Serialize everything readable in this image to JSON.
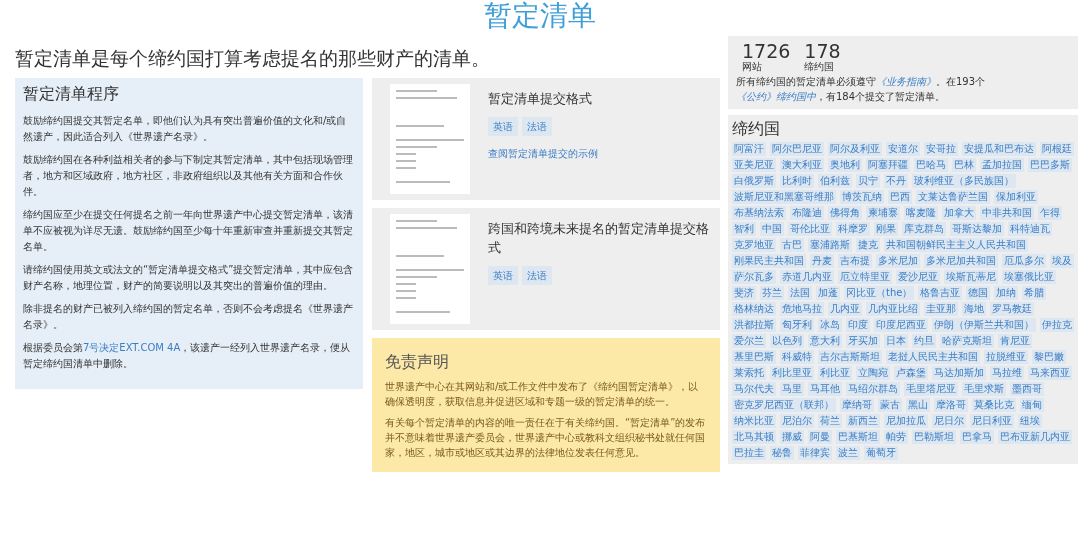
{
  "page_title": "暂定清单",
  "intro": "暂定清单是每个缔约国打算考虑提名的那些财产的清单。",
  "procedure": {
    "title": "暂定清单程序",
    "paragraphs": [
      {
        "segments": [
          {
            "text": "鼓励缔约国提交其暂定名单，即他们认为具有突出普遍价值的文化和/或自然遗产，因此适合列入《世界遗产名录》。",
            "kind": "text"
          }
        ]
      },
      {
        "segments": [
          {
            "text": "鼓励缔约国在各种利益相关者的参与下制定其暂定清单，其中包括现场管理者，地方和区域政府，地方社区，非政府组织以及其他有关方面和合作伙伴。",
            "kind": "text"
          }
        ]
      },
      {
        "segments": [
          {
            "text": "缔约国应至少在提交任何提名之前一年向世界遗产中心提交暂定清单，该清单不应被视为详尽无遗。鼓励缔约国至少每十年重新审查并重新提交其暂定名单。",
            "kind": "text"
          }
        ]
      },
      {
        "segments": [
          {
            "text": "请缔约国使用英文或法文的“暂定清单提交格式”提交暂定清单，其中应包含财产名称，地理位置，财产的简要说明以及其突出的普遍价值的理由。",
            "kind": "text"
          }
        ]
      },
      {
        "segments": [
          {
            "text": "除非提名的财产已被列入缔约国的暂定名单，否则不会考虑提名《世界遗产名录》。",
            "kind": "text"
          }
        ]
      },
      {
        "segments": [
          {
            "text": "根据委员会第",
            "kind": "text"
          },
          {
            "text": "7号决定EXT.COM 4A",
            "kind": "link"
          },
          {
            "text": "，该遗产一经列入世界遗产名录，便从暂定缔约国清单中删除。",
            "kind": "text"
          }
        ]
      }
    ]
  },
  "documents": [
    {
      "title": "暂定清单提交格式",
      "languages": [
        "英语",
        "法语"
      ],
      "example_link": "查阅暂定清单提交的示例"
    },
    {
      "title": "跨国和跨境未来提名的暂定清单提交格式",
      "languages": [
        "英语",
        "法语"
      ]
    }
  ],
  "disclaimer": {
    "title": "免责声明",
    "paragraphs": [
      "世界遗产中心在其网站和/或工作文件中发布了《缔约国暂定清单》，以确保透明度，获取信息并促进区域和专题一级的暂定清单的统一。",
      "有关每个暂定清单的内容的唯一责任在于有关缔约国。“暂定清单”的发布并不意味着世界遗产委员会，世界遗产中心或教科文组织秘书处就任何国家，地区，城市或地区或其边界的法律地位发表任何意见。"
    ]
  },
  "stats": [
    {
      "number": "1726",
      "label": "网站"
    },
    {
      "number": "178",
      "label": "缔约国"
    }
  ],
  "stats_note": {
    "segments": [
      {
        "text": "所有缔约国的暂定清单必须遵守",
        "kind": "text"
      },
      {
        "text": "《业务指南》",
        "kind": "link"
      },
      {
        "text": "。在193个",
        "kind": "text"
      },
      {
        "text": "《公约》缔约国中",
        "kind": "link"
      },
      {
        "text": "，有184个提交了暂定清单。",
        "kind": "text"
      }
    ]
  },
  "states_parties": {
    "title": "缔约国",
    "countries": [
      "阿富汗",
      "阿尔巴尼亚",
      "阿尔及利亚",
      "安道尔",
      "安哥拉",
      "安提瓜和巴布达",
      "阿根廷",
      "亚美尼亚",
      "澳大利亚",
      "奥地利",
      "阿塞拜疆",
      "巴哈马",
      "巴林",
      "孟加拉国",
      "巴巴多斯",
      "白俄罗斯",
      "比利时",
      "伯利兹",
      "贝宁",
      "不丹",
      "玻利维亚（多民族国）",
      "波斯尼亚和黑塞哥维那",
      "博茨瓦纳",
      "巴西",
      "文莱达鲁萨兰国",
      "保加利亚",
      "布基纳法索",
      "布隆迪",
      "佛得角",
      "柬埔寨",
      "喀麦隆",
      "加拿大",
      "中非共和国",
      "乍得",
      "智利",
      "中国",
      "哥伦比亚",
      "科摩罗",
      "刚果",
      "库克群岛",
      "哥斯达黎加",
      "科特迪瓦",
      "克罗地亚",
      "古巴",
      "塞浦路斯",
      "捷克",
      "共和国朝鲜民主主义人民共和国",
      "刚果民主共和国",
      "丹麦",
      "吉布提",
      "多米尼加",
      "多米尼加共和国",
      "厄瓜多尔",
      "埃及",
      "萨尔瓦多",
      "赤道几内亚",
      "厄立特里亚",
      "爱沙尼亚",
      "埃斯瓦蒂尼",
      "埃塞俄比亚",
      "斐济",
      "芬兰",
      "法国",
      "加蓬",
      "冈比亚（the）",
      "格鲁吉亚",
      "德国",
      "加纳",
      "希腊",
      "格林纳达",
      "危地马拉",
      "几内亚",
      "几内亚比绍",
      "圭亚那",
      "海地",
      "罗马教廷",
      "洪都拉斯",
      "匈牙利",
      "冰岛",
      "印度",
      "印度尼西亚",
      "伊朗（伊斯兰共和国）",
      "伊拉克",
      "爱尔兰",
      "以色列",
      "意大利",
      "牙买加",
      "日本",
      "约旦",
      "哈萨克斯坦",
      "肯尼亚",
      "基里巴斯",
      "科威特",
      "吉尔吉斯斯坦",
      "老挝人民民主共和国",
      "拉脱维亚",
      "黎巴嫩",
      "莱索托",
      "利比里亚",
      "利比亚",
      "立陶宛",
      "卢森堡",
      "马达加斯加",
      "马拉维",
      "马来西亚",
      "马尔代夫",
      "马里",
      "马耳他",
      "马绍尔群岛",
      "毛里塔尼亚",
      "毛里求斯",
      "墨西哥",
      "密克罗尼西亚（联邦）",
      "摩纳哥",
      "蒙古",
      "黑山",
      "摩洛哥",
      "莫桑比克",
      "缅甸",
      "纳米比亚",
      "尼泊尔",
      "荷兰",
      "新西兰",
      "尼加拉瓜",
      "尼日尔",
      "尼日利亚",
      "纽埃",
      "北马其顿",
      "挪威",
      "阿曼",
      "巴基斯坦",
      "帕劳",
      "巴勒斯坦",
      "巴拿马",
      "巴布亚新几内亚",
      "巴拉圭",
      "秘鲁",
      "菲律宾",
      "波兰",
      "葡萄牙"
    ]
  }
}
